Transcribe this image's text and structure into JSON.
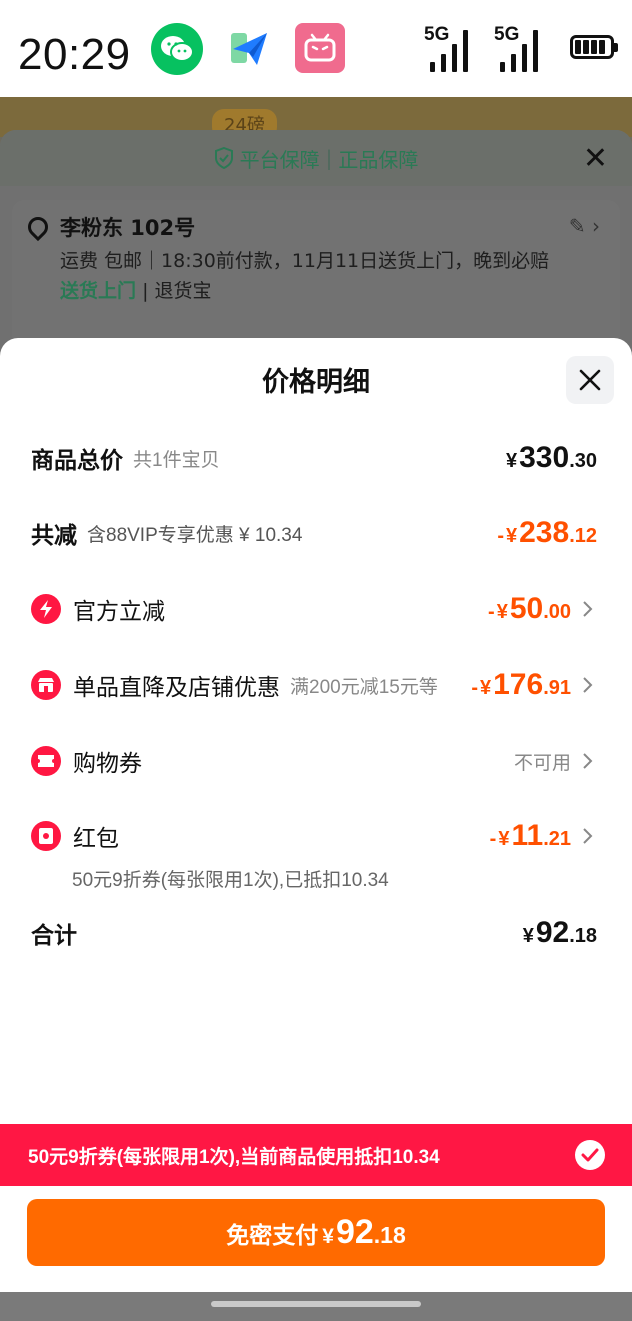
{
  "status_bar": {
    "time": "20:29",
    "apps": [
      "wechat-icon",
      "paper-plane-icon",
      "bilibili-icon"
    ],
    "signal_1": "5G",
    "signal_2": "5G",
    "battery": "battery-icon"
  },
  "background": {
    "promo_tag": "24磅",
    "guarantee": {
      "part1": "平台保障",
      "part2": "正品保障"
    },
    "address": {
      "name": "李粉东 102号",
      "shipping": "运费 包邮｜18:30前付款，11月11日送货上门，晚到必赔",
      "delivery_tag": "送货上门",
      "return_tag": "退货宝"
    }
  },
  "sheet": {
    "title": "价格明细",
    "rows": [
      {
        "label": "商品总价",
        "sub": "共1件宝贝",
        "cur": "¥",
        "int": "330",
        "dec": ".30",
        "color": "#111111"
      },
      {
        "label": "共减",
        "sub": "含88VIP专享优惠 ¥ 10.34",
        "prefix": "-",
        "cur": "¥",
        "int": "238",
        "dec": ".12",
        "color": "#ff5000"
      },
      {
        "label": "官方立减",
        "prefix": "-",
        "cur": "¥",
        "int": "50",
        "dec": ".00",
        "icon": "lightning-icon",
        "color": "#ff5000"
      },
      {
        "label": "单品直降及店铺优惠",
        "sub": "满200元减15元等",
        "prefix": "-",
        "cur": "¥",
        "int": "176",
        "dec": ".91",
        "icon": "shop-icon",
        "color": "#ff5000"
      },
      {
        "label": "购物券",
        "status": "不可用",
        "icon": "coupon-icon"
      },
      {
        "label": "红包",
        "note": "50元9折券(每张限用1次),已抵扣10.34",
        "prefix": "-",
        "cur": "¥",
        "int": "11",
        "dec": ".21",
        "icon": "red-envelope-icon",
        "color": "#ff5000"
      },
      {
        "label": "合计",
        "cur": "¥",
        "int": "92",
        "dec": ".18",
        "color": "#111111"
      }
    ]
  },
  "banner": {
    "text": "50元9折券(每张限用1次),当前商品使用抵扣10.34"
  },
  "pay_button": {
    "label": "免密支付",
    "cur": "¥",
    "int": "92",
    "dec": ".18"
  }
}
